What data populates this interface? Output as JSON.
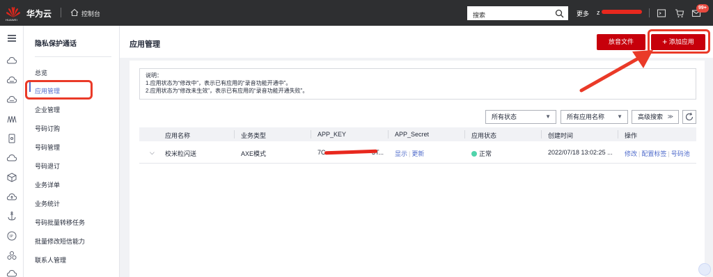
{
  "topbar": {
    "logo_text": "HUAWEI",
    "brand": "华为云",
    "console": "控制台",
    "search_placeholder": "搜索",
    "more": "更多",
    "user": "z",
    "badge": "99+"
  },
  "sidebar": {
    "title": "隐私保护通话",
    "items": [
      {
        "label": "总览"
      },
      {
        "label": "应用管理"
      },
      {
        "label": "企业管理"
      },
      {
        "label": "号码订购"
      },
      {
        "label": "号码管理"
      },
      {
        "label": "号码退订"
      },
      {
        "label": "业务详单"
      },
      {
        "label": "业务统计"
      },
      {
        "label": "号码批量转移任务"
      },
      {
        "label": "批量修改短信能力"
      },
      {
        "label": "联系人管理"
      }
    ]
  },
  "main": {
    "title": "应用管理",
    "btn_audio": "放音文件",
    "btn_add": "添加应用",
    "note": {
      "line1": "说明：",
      "line2": "1.应用状态为“修改中”，表示已有应用的“录音功能开通中”。",
      "line3": "2.应用状态为“修改未生效”，表示已有应用的“录音功能开通失败”。"
    },
    "filters": {
      "status": "所有状态",
      "app_name": "所有应用名称",
      "advanced": "高级搜索"
    },
    "table": {
      "headers": [
        "应用名称",
        "业务类型",
        "APP_KEY",
        "APP_Secret",
        "应用状态",
        "创建时间",
        "操作"
      ],
      "row": {
        "name": "校米粒闪送",
        "type": "AXE模式",
        "key_start": "7C",
        "key_end": "3T...",
        "secret_show": "显示",
        "secret_update": "更新",
        "status": "正常",
        "created": "2022/07/18 13:02:25 ...",
        "op_edit": "修改",
        "op_tag": "配置标签",
        "op_pool": "号码池"
      }
    }
  },
  "colors": {
    "topbar": "#2e2f31",
    "brand_red": "#c7000b",
    "link_blue": "#526ecc",
    "annotation_red": "#ea3a28"
  }
}
